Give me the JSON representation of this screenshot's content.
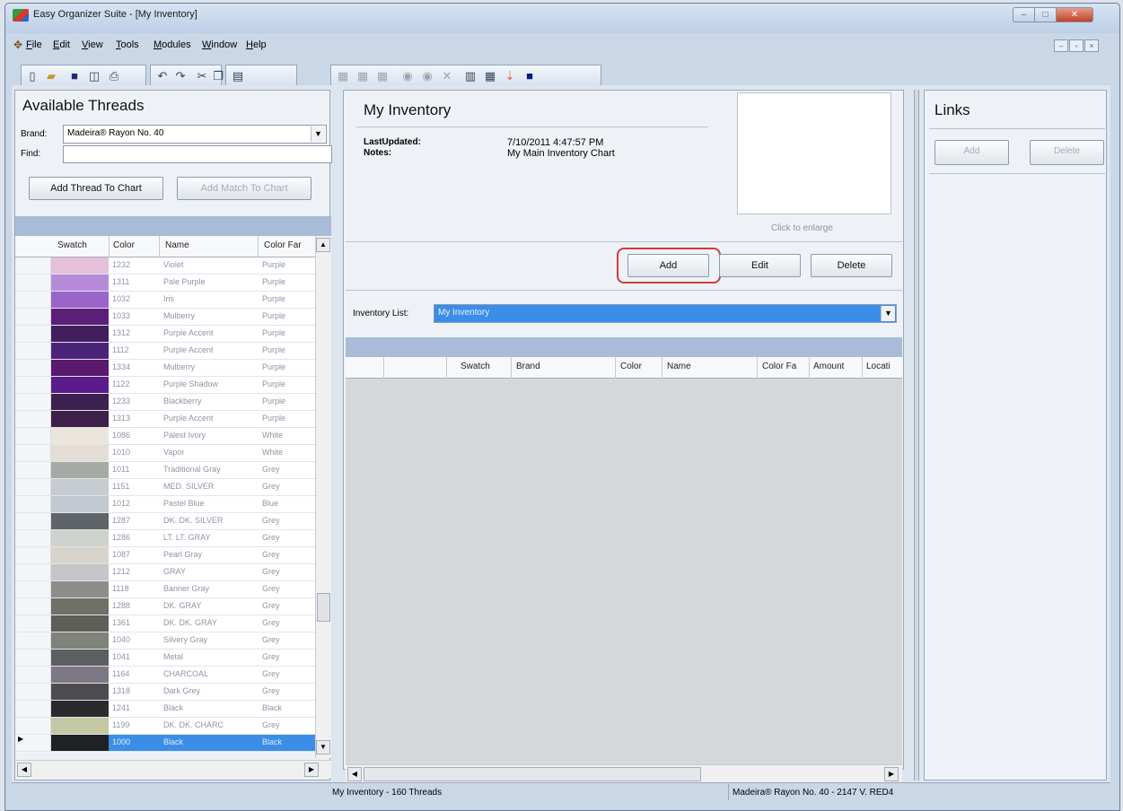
{
  "window": {
    "title": "Easy Organizer Suite - [My Inventory]",
    "caption_buttons": [
      "minimize-icon",
      "maximize-icon",
      "close-icon"
    ]
  },
  "menu": [
    "File",
    "Edit",
    "View",
    "Tools",
    "Modules",
    "Window",
    "Help"
  ],
  "left_panel": {
    "title": "Available Threads",
    "brand_label": "Brand:",
    "brand_value": "Madeira® Rayon No. 40",
    "find_label": "Find:",
    "find_value": "",
    "add_thread_button": "Add Thread To Chart",
    "add_match_button": "Add Match To Chart",
    "columns": [
      "Swatch",
      "Color",
      "Name",
      "Color Far"
    ],
    "rows": [
      {
        "swatch": "#e6bfd9",
        "color": "1232",
        "name": "Violet",
        "family": "Purple"
      },
      {
        "swatch": "#b78ad9",
        "color": "1311",
        "name": "Pale Purple",
        "family": "Purple"
      },
      {
        "swatch": "#9a64c8",
        "color": "1032",
        "name": "Iris",
        "family": "Purple"
      },
      {
        "swatch": "#5b1f7a",
        "color": "1033",
        "name": "Mulberry",
        "family": "Purple"
      },
      {
        "swatch": "#421f5c",
        "color": "1312",
        "name": "Purple Accent",
        "family": "Purple"
      },
      {
        "swatch": "#4b2478",
        "color": "1112",
        "name": "Purple Accent",
        "family": "Purple"
      },
      {
        "swatch": "#5a1a6e",
        "color": "1334",
        "name": "Mulberry",
        "family": "Purple"
      },
      {
        "swatch": "#5b1b8c",
        "color": "1122",
        "name": "Purple Shadow",
        "family": "Purple"
      },
      {
        "swatch": "#3c2150",
        "color": "1233",
        "name": "Blackberry",
        "family": "Purple"
      },
      {
        "swatch": "#3f1f48",
        "color": "1313",
        "name": "Purple Accent",
        "family": "Purple"
      },
      {
        "swatch": "#ebe5dc",
        "color": "1086",
        "name": "Palest Ivory",
        "family": "White"
      },
      {
        "swatch": "#e3ddd6",
        "color": "1010",
        "name": "Vapor",
        "family": "White"
      },
      {
        "swatch": "#a7aaa4",
        "color": "1011",
        "name": "Traditional Gray",
        "family": "Grey"
      },
      {
        "swatch": "#c7ccd1",
        "color": "1151",
        "name": "MED. SILVER",
        "family": "Grey"
      },
      {
        "swatch": "#c2c9d0",
        "color": "1012",
        "name": "Pastel Blue",
        "family": "Blue"
      },
      {
        "swatch": "#5e6467",
        "color": "1287",
        "name": "DK. DK. SILVER",
        "family": "Grey"
      },
      {
        "swatch": "#cfd1cc",
        "color": "1286",
        "name": "LT. LT. GRAY",
        "family": "Grey"
      },
      {
        "swatch": "#d8d4cc",
        "color": "1087",
        "name": "Pearl Gray",
        "family": "Grey"
      },
      {
        "swatch": "#c6c6c8",
        "color": "1212",
        "name": "GRAY",
        "family": "Grey"
      },
      {
        "swatch": "#8c8f89",
        "color": "1118",
        "name": "Banner Gray",
        "family": "Grey"
      },
      {
        "swatch": "#6f7166",
        "color": "1288",
        "name": "DK. GRAY",
        "family": "Grey"
      },
      {
        "swatch": "#5d5f58",
        "color": "1361",
        "name": "DK. DK. GRAY",
        "family": "Grey"
      },
      {
        "swatch": "#7f8279",
        "color": "1040",
        "name": "Silvery Gray",
        "family": "Grey"
      },
      {
        "swatch": "#5c5f61",
        "color": "1041",
        "name": "Metal",
        "family": "Grey"
      },
      {
        "swatch": "#7e7884",
        "color": "1164",
        "name": "CHARCOAL",
        "family": "Grey"
      },
      {
        "swatch": "#4d4d4f",
        "color": "1318",
        "name": "Dark Grey",
        "family": "Grey"
      },
      {
        "swatch": "#2a2b2d",
        "color": "1241",
        "name": "Black",
        "family": "Black"
      },
      {
        "swatch": "#c4c7a3",
        "color": "1199",
        "name": "DK. DK. CHARC",
        "family": "Grey"
      },
      {
        "swatch": "#1f2124",
        "color": "1000",
        "name": "Black",
        "family": "Black"
      }
    ]
  },
  "inventory_panel": {
    "title": "My Inventory",
    "last_updated_label": "LastUpdated:",
    "last_updated_value": "7/10/2011 4:47:57 PM",
    "notes_label": "Notes:",
    "notes_value": "My Main Inventory Chart",
    "image_caption": "Click to enlarge",
    "add_button": "Add",
    "edit_button": "Edit",
    "delete_button": "Delete",
    "inventory_list_label": "Inventory List:",
    "inventory_list_value": "My Inventory",
    "columns": [
      "Swatch",
      "Brand",
      "Color",
      "Name",
      "Color Fa",
      "Amount",
      "Locati"
    ]
  },
  "links_panel": {
    "title": "Links",
    "add_button": "Add",
    "delete_button": "Delete"
  },
  "status": {
    "left": "My Inventory - 160 Threads",
    "right": "Madeira® Rayon No. 40 - 2147 V. RED4"
  },
  "colors": {
    "highlight": "#d23b3b",
    "selection": "#3b8ee8"
  }
}
